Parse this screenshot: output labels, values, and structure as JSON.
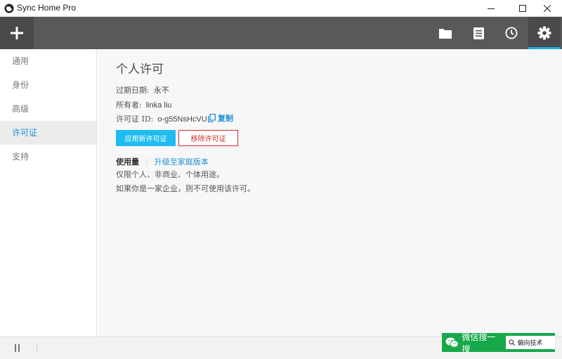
{
  "window": {
    "title": "Sync Home Pro"
  },
  "toolbar": {
    "add_icon": "plus-icon",
    "buttons": [
      "folder-icon",
      "document-icon",
      "clock-icon",
      "gear-icon"
    ],
    "active": "gear-icon",
    "accent_color": "#1ea7e4"
  },
  "sidebar": {
    "items": [
      {
        "label": "通用"
      },
      {
        "label": "身份"
      },
      {
        "label": "高级"
      },
      {
        "label": "许可证",
        "active": true
      },
      {
        "label": "支持"
      }
    ]
  },
  "main": {
    "title": "个人许可",
    "expiry_label": "过期日期:",
    "expiry_value": "永不",
    "owner_label": "所有者:",
    "owner_value": "linka liu",
    "license_label": "许可证 ID:",
    "license_value": "o-g55NsHcVU",
    "copy_label": "复制",
    "apply_button": "应用新许可证",
    "remove_button": "移除许可证",
    "usage_label": "使用量",
    "upgrade_link": "升级至家庭版本",
    "note_1": "仅限个人、非商业、个体用途。",
    "note_2": "如果你是一家企业，则不可使用该许可。"
  },
  "watermark": {
    "label": "微信搜一搜",
    "search_text": "偏向技术"
  }
}
